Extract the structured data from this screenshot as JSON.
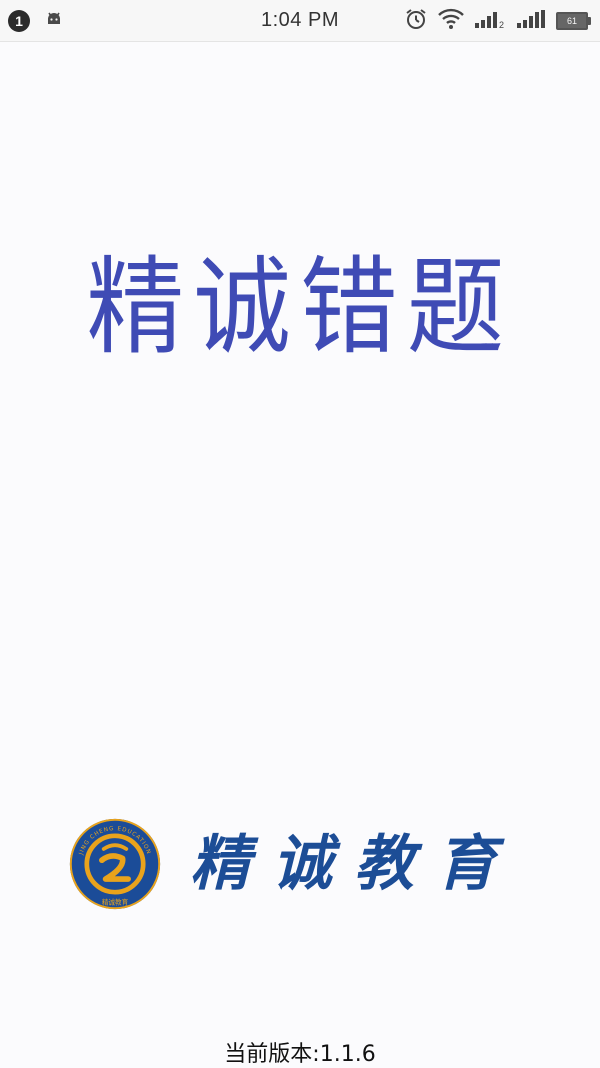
{
  "status_bar": {
    "notification_count": "1",
    "time": "1:04 PM",
    "battery": "61",
    "icons": [
      "notification-badge",
      "android-icon",
      "alarm-icon",
      "wifi-icon",
      "signal-icon",
      "signal-icon",
      "battery-icon"
    ]
  },
  "app": {
    "title": "精诚错题",
    "brand_name": "精诚教育",
    "logo_ring_text": "JING CHENG EDUCATION",
    "logo_bottom_text": "精诚教育",
    "version_label": "当前版本:1.1.6"
  },
  "colors": {
    "title": "#3f4bb5",
    "brand": "#1c4d96",
    "logo_gold": "#e9a31c",
    "background": "#fbfbfd"
  }
}
